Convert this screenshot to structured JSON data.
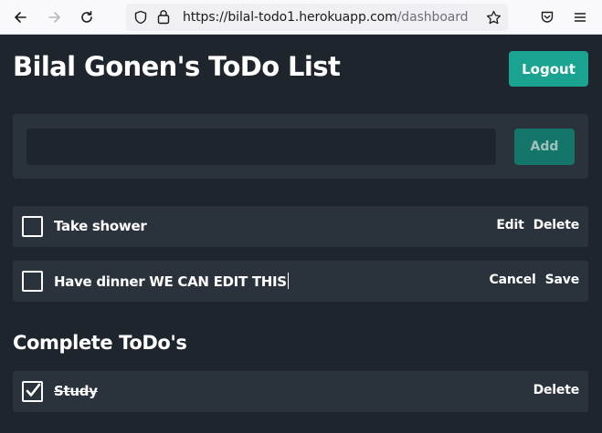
{
  "browser": {
    "url_main": "https://bilal-todo1.herokuapp.com",
    "url_path": "/dashboard"
  },
  "app": {
    "title": "Bilal Gonen's ToDo List",
    "logout_label": "Logout",
    "add_input_value": "",
    "add_label": "Add"
  },
  "todos": [
    {
      "text": "Take shower",
      "checked": false,
      "actions": [
        "Edit",
        "Delete"
      ]
    },
    {
      "text": "Have dinner WE CAN EDIT THIS",
      "checked": false,
      "editing": true,
      "actions": [
        "Cancel",
        "Save"
      ]
    }
  ],
  "complete": {
    "heading": "Complete ToDo's",
    "items": [
      {
        "text": "Study",
        "checked": true,
        "actions": [
          "Delete"
        ]
      }
    ]
  },
  "colors": {
    "background": "#1e252d",
    "panel": "#2a323b",
    "accent": "#1aa390",
    "accent_dim": "#14766a"
  }
}
